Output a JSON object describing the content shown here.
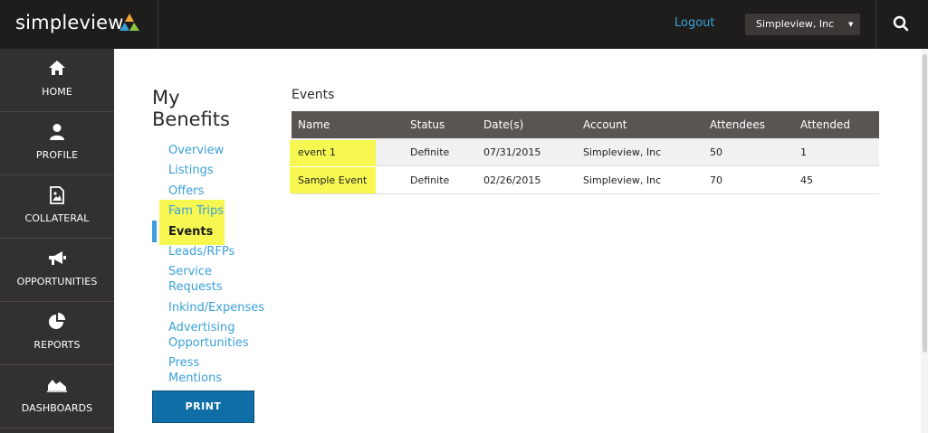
{
  "header": {
    "brand": "simpleview",
    "logout_label": "Logout",
    "account_selected": "Simpleview, Inc"
  },
  "sidebar": {
    "items": [
      {
        "label": "HOME",
        "icon": "home-icon"
      },
      {
        "label": "PROFILE",
        "icon": "person-icon"
      },
      {
        "label": "COLLATERAL",
        "icon": "image-file-icon"
      },
      {
        "label": "OPPORTUNITIES",
        "icon": "megaphone-icon"
      },
      {
        "label": "REPORTS",
        "icon": "pie-chart-icon"
      },
      {
        "label": "DASHBOARDS",
        "icon": "area-chart-icon"
      }
    ]
  },
  "benefits": {
    "title": "My Benefits",
    "nav": [
      {
        "label": "Overview"
      },
      {
        "label": "Listings"
      },
      {
        "label": "Offers"
      },
      {
        "label": "Fam Trips"
      },
      {
        "label": "Events"
      },
      {
        "label": "Leads/RFPs"
      },
      {
        "label": "Service Requests"
      },
      {
        "label": "Inkind/Expenses"
      },
      {
        "label": "Advertising Opportunities"
      },
      {
        "label": "Press Mentions"
      }
    ],
    "print_label": "PRINT"
  },
  "events": {
    "title": "Events",
    "columns": [
      "Name",
      "Status",
      "Date(s)",
      "Account",
      "Attendees",
      "Attended"
    ],
    "rows": [
      [
        "event 1",
        "Definite",
        "07/31/2015",
        "Simpleview, Inc",
        "50",
        "1"
      ],
      [
        "Sample Event",
        "Definite",
        "02/26/2015",
        "Simpleview, Inc",
        "70",
        "45"
      ]
    ]
  },
  "colors": {
    "link": "#3aa0d9",
    "highlight": "#f7f751",
    "topbar": "#1f1d1c",
    "sidebar": "#333130",
    "table_header": "#5b5552",
    "print_button": "#0e6ea5"
  }
}
